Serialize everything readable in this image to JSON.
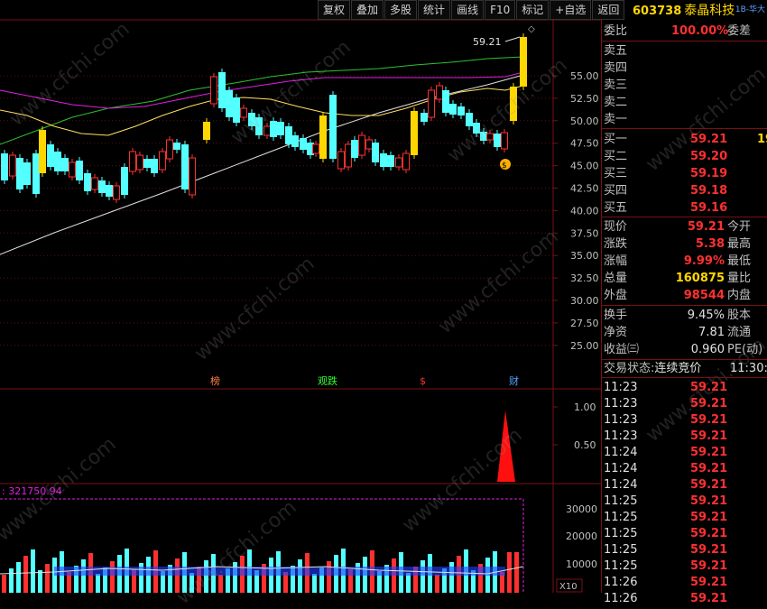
{
  "toolbar": {
    "items": [
      "复权",
      "叠加",
      "多股",
      "统计",
      "画线",
      "F10",
      "标记",
      "+自选",
      "返回"
    ]
  },
  "header": {
    "code": "603738",
    "name": "泰晶科技",
    "sub": "1B-华大"
  },
  "main_chart": {
    "price_axis": [
      "55.00",
      "52.50",
      "50.00",
      "47.50",
      "45.00",
      "42.50",
      "40.00",
      "37.50",
      "35.00",
      "32.50",
      "30.00",
      "27.50",
      "25.00"
    ],
    "high_label": "59.21",
    "markers": [
      "榜",
      "观跌",
      "$",
      "财"
    ]
  },
  "indicator": {
    "axis": [
      "1.00",
      "0.50"
    ]
  },
  "volume": {
    "label": ": 321750.94",
    "axis": [
      "30000",
      "20000",
      "10000"
    ],
    "unit": "X10"
  },
  "order_book": {
    "weibi_label": "委比",
    "weibi_value": "100.00%",
    "weicha_label": "委差",
    "sells": [
      {
        "label": "卖五"
      },
      {
        "label": "卖四"
      },
      {
        "label": "卖三"
      },
      {
        "label": "卖二"
      },
      {
        "label": "卖一"
      }
    ],
    "buys": [
      {
        "label": "买一",
        "price": "59.21",
        "vol": "19"
      },
      {
        "label": "买二",
        "price": "59.20",
        "vol": ""
      },
      {
        "label": "买三",
        "price": "59.19",
        "vol": ""
      },
      {
        "label": "买四",
        "price": "59.18",
        "vol": ""
      },
      {
        "label": "买五",
        "price": "59.16",
        "vol": ""
      }
    ]
  },
  "quote": {
    "rows": [
      {
        "l": "现价",
        "v": "59.21",
        "r": "今开",
        "c": "red"
      },
      {
        "l": "涨跌",
        "v": "5.38",
        "r": "最高",
        "c": "red"
      },
      {
        "l": "涨幅",
        "v": "9.99%",
        "r": "最低",
        "c": "red"
      },
      {
        "l": "总量",
        "v": "160875",
        "r": "量比",
        "c": "yel"
      },
      {
        "l": "外盘",
        "v": "98544",
        "r": "内盘",
        "c": "red"
      }
    ],
    "rows2": [
      {
        "l": "换手",
        "v": "9.45%",
        "r": "股本"
      },
      {
        "l": "净资",
        "v": "7.81",
        "r": "流通"
      },
      {
        "l": "收益㈢",
        "v": "0.960",
        "r": "PE(动)"
      }
    ]
  },
  "trade": {
    "status_label": "交易状态:",
    "status_value": "连续竞价",
    "time": "11:30:"
  },
  "ticks": [
    {
      "t": "11:23",
      "p": "59.21"
    },
    {
      "t": "11:23",
      "p": "59.21"
    },
    {
      "t": "11:23",
      "p": "59.21"
    },
    {
      "t": "11:23",
      "p": "59.21"
    },
    {
      "t": "11:24",
      "p": "59.21"
    },
    {
      "t": "11:24",
      "p": "59.21"
    },
    {
      "t": "11:24",
      "p": "59.21"
    },
    {
      "t": "11:25",
      "p": "59.21"
    },
    {
      "t": "11:25",
      "p": "59.21"
    },
    {
      "t": "11:25",
      "p": "59.21"
    },
    {
      "t": "11:25",
      "p": "59.21"
    },
    {
      "t": "11:25",
      "p": "59.21"
    },
    {
      "t": "11:26",
      "p": "59.21"
    },
    {
      "t": "11:26",
      "p": "59.21"
    }
  ],
  "watermark": "www.cfchi.com",
  "colors": {
    "up": "#ff3030",
    "down": "#54ffff",
    "limit": "#ffd700",
    "grid": "#7a1010"
  }
}
